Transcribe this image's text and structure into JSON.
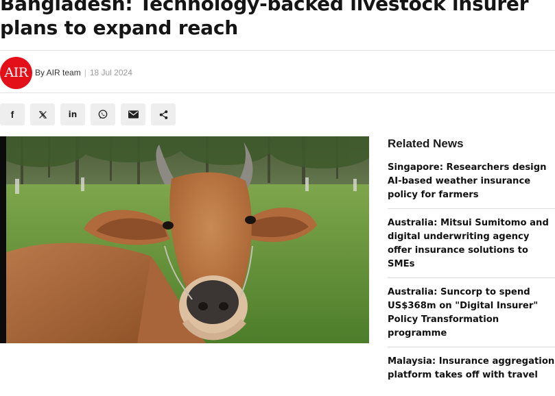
{
  "article": {
    "title_line1": "Bangladesh: Technology-backed livestock insurer",
    "title_line2": "plans to expand reach",
    "author_logo_text": "AIR",
    "author": "By AIR team",
    "separator": "|",
    "date": "18 Jul 2024"
  },
  "share": {
    "buttons": [
      {
        "icon": "facebook-icon",
        "glyph": "f"
      },
      {
        "icon": "x-twitter-icon",
        "glyph": "𝕏"
      },
      {
        "icon": "linkedin-icon",
        "glyph": "in"
      },
      {
        "icon": "whatsapp-icon",
        "glyph": ""
      },
      {
        "icon": "email-icon",
        "glyph": ""
      },
      {
        "icon": "share-icon",
        "glyph": ""
      }
    ]
  },
  "hero_image": {
    "subject": "cow-photo"
  },
  "related": {
    "heading": "Related News",
    "items": [
      "Singapore: Researchers design AI-based weather insurance policy for farmers",
      "Australia: Mitsui Sumitomo and digital underwriting agency offer insurance solutions to SMEs",
      "Australia: Suncorp to spend US$368m on \"Digital Insurer\" Policy Transformation programme",
      "Malaysia: Insurance aggregation platform takes off with travel"
    ]
  },
  "colors": {
    "brand_red": "#e3101a",
    "title": "#151515",
    "share_bg": "#eeeeee"
  }
}
